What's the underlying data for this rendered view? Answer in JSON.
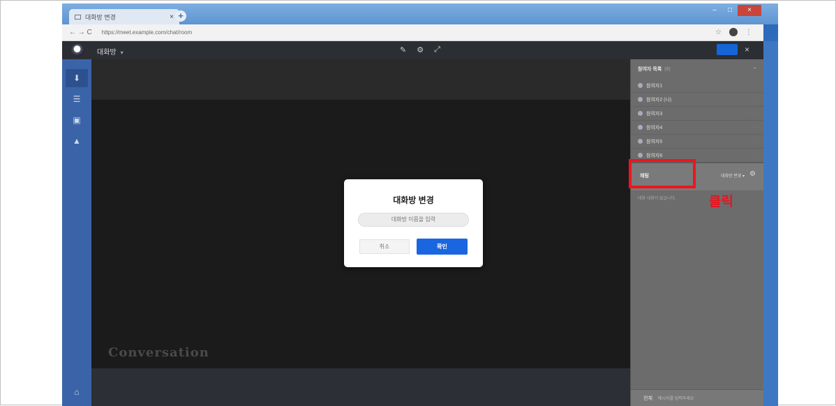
{
  "browser": {
    "tab_title": "대화방 변경",
    "tab_close": "×",
    "new_tab": "+",
    "nav": "←  →  C",
    "url": "https://meet.example.com/chat/room",
    "window_controls": [
      "–",
      "□",
      "×"
    ],
    "toolbar_icons": [
      "☆",
      "⋮"
    ]
  },
  "app": {
    "room_name": "대화방",
    "room_dropdown": "▾",
    "center_icons": [
      "✎",
      "⚙",
      "⤢"
    ],
    "close": "×",
    "stage_caption": "Conversation",
    "sidebar_items": [
      "⬇",
      "☰",
      "▣",
      "▲"
    ],
    "sidebar_bottom": "⌂"
  },
  "panel": {
    "title": "참여자 목록",
    "title_count": "(6)",
    "collapse": "−",
    "participants": [
      {
        "name": "참여자1",
        "count": ""
      },
      {
        "name": "참여자2 (나)",
        "count": "· ·"
      },
      {
        "name": "참여자3",
        "count": "· ·"
      },
      {
        "name": "참여자4",
        "count": "· ·"
      },
      {
        "name": "참여자5",
        "count": "· ·"
      },
      {
        "name": "참여자6",
        "count": "· ·"
      }
    ],
    "chat_label": "채팅",
    "chat_select": "대화방 변경 ▾",
    "chat_gear": "⚙",
    "chat_note": "대화 내용이 없습니다.",
    "footer_label": "전체",
    "footer_hint": "메시지를 입력하세요"
  },
  "annotation": {
    "label": "클릭",
    "color": "#f0141e"
  },
  "modal": {
    "title": "대화방 변경",
    "input_value": "대화방 이름을 입력",
    "cancel_label": "취소",
    "ok_label": "확인"
  }
}
